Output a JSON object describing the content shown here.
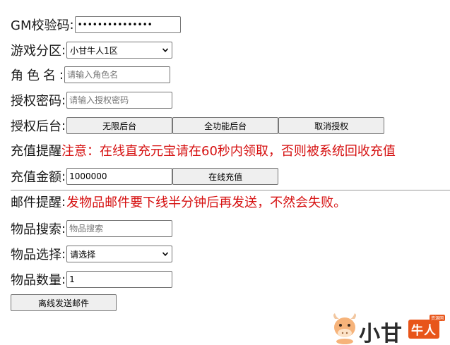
{
  "gm_code": {
    "label": "GM校验码",
    "value": "•••••••••••••••"
  },
  "zone": {
    "label": "游戏分区",
    "selected": "小甘牛人1区"
  },
  "role_name": {
    "label": "角色名",
    "placeholder": "请输入角色名"
  },
  "auth_password": {
    "label": "授权密码",
    "placeholder": "请输入授权密码"
  },
  "auth_backend": {
    "label": "授权后台",
    "buttons": [
      "无限后台",
      "全功能后台",
      "取消授权"
    ]
  },
  "recharge_notice": {
    "label": "充值提醒",
    "text": "注意：在线直充元宝请在60秒内领取，否则被系统回收充值"
  },
  "recharge_amount": {
    "label": "充值金额",
    "value": "1000000",
    "button": "在线充值"
  },
  "mail_notice": {
    "label": "邮件提醒",
    "text": "发物品邮件要下线半分钟后再发送，不然会失败。"
  },
  "item_search": {
    "label": "物品搜索",
    "placeholder": "物品搜索"
  },
  "item_select": {
    "label": "物品选择",
    "selected": "请选择"
  },
  "item_quantity": {
    "label": "物品数量",
    "value": "1"
  },
  "send_mail_button": "离线发送邮件",
  "colon": ":",
  "logo": {
    "text": "小甘",
    "badge": "牛人",
    "tag": "资源网"
  },
  "colors": {
    "notice_red": "#d61111",
    "logo_orange": "#e8551a"
  },
  "icons": {
    "dropdown": "chevron-down-icon",
    "logo": "bull-mascot-icon"
  }
}
